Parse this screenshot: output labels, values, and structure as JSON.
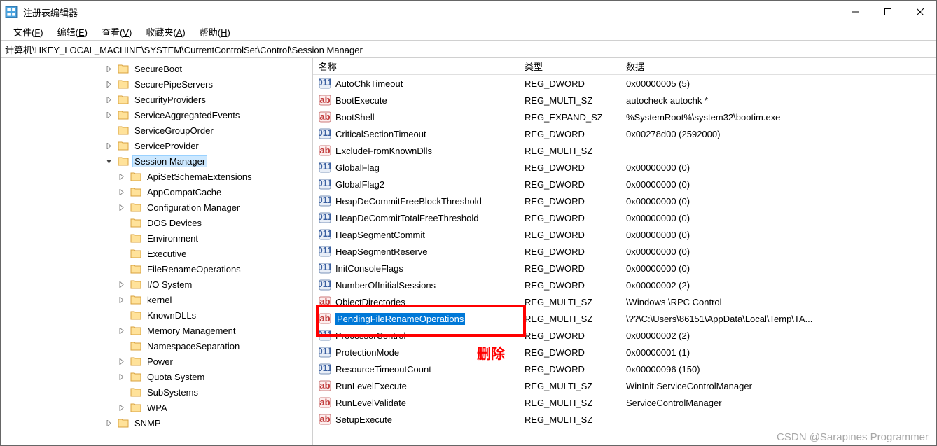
{
  "window": {
    "title": "注册表编辑器"
  },
  "menu": {
    "file": "文件(F)",
    "edit": "编辑(E)",
    "view": "查看(V)",
    "favorites": "收藏夹(A)",
    "help": "帮助(H)"
  },
  "address": {
    "path": "计算机\\HKEY_LOCAL_MACHINE\\SYSTEM\\CurrentControlSet\\Control\\Session Manager"
  },
  "tree": [
    {
      "depth": 3,
      "twisty": ">",
      "label": "SecureBoot"
    },
    {
      "depth": 3,
      "twisty": ">",
      "label": "SecurePipeServers"
    },
    {
      "depth": 3,
      "twisty": ">",
      "label": "SecurityProviders"
    },
    {
      "depth": 3,
      "twisty": ">",
      "label": "ServiceAggregatedEvents"
    },
    {
      "depth": 3,
      "twisty": "",
      "label": "ServiceGroupOrder"
    },
    {
      "depth": 3,
      "twisty": ">",
      "label": "ServiceProvider"
    },
    {
      "depth": 3,
      "twisty": "v",
      "label": "Session Manager",
      "selected": true
    },
    {
      "depth": 4,
      "twisty": ">",
      "label": "ApiSetSchemaExtensions"
    },
    {
      "depth": 4,
      "twisty": ">",
      "label": "AppCompatCache"
    },
    {
      "depth": 4,
      "twisty": ">",
      "label": "Configuration Manager"
    },
    {
      "depth": 4,
      "twisty": "",
      "label": "DOS Devices"
    },
    {
      "depth": 4,
      "twisty": "",
      "label": "Environment"
    },
    {
      "depth": 4,
      "twisty": "",
      "label": "Executive"
    },
    {
      "depth": 4,
      "twisty": "",
      "label": "FileRenameOperations"
    },
    {
      "depth": 4,
      "twisty": ">",
      "label": "I/O System"
    },
    {
      "depth": 4,
      "twisty": ">",
      "label": "kernel"
    },
    {
      "depth": 4,
      "twisty": "",
      "label": "KnownDLLs"
    },
    {
      "depth": 4,
      "twisty": ">",
      "label": "Memory Management"
    },
    {
      "depth": 4,
      "twisty": "",
      "label": "NamespaceSeparation"
    },
    {
      "depth": 4,
      "twisty": ">",
      "label": "Power"
    },
    {
      "depth": 4,
      "twisty": ">",
      "label": "Quota System"
    },
    {
      "depth": 4,
      "twisty": "",
      "label": "SubSystems"
    },
    {
      "depth": 4,
      "twisty": ">",
      "label": "WPA"
    },
    {
      "depth": 3,
      "twisty": ">",
      "label": "SNMP"
    }
  ],
  "columns": {
    "name": "名称",
    "type": "类型",
    "data": "数据"
  },
  "values": [
    {
      "icon": "bin",
      "name": "AutoChkTimeout",
      "type": "REG_DWORD",
      "data": "0x00000005 (5)"
    },
    {
      "icon": "str",
      "name": "BootExecute",
      "type": "REG_MULTI_SZ",
      "data": "autocheck autochk *"
    },
    {
      "icon": "str",
      "name": "BootShell",
      "type": "REG_EXPAND_SZ",
      "data": "%SystemRoot%\\system32\\bootim.exe"
    },
    {
      "icon": "bin",
      "name": "CriticalSectionTimeout",
      "type": "REG_DWORD",
      "data": "0x00278d00 (2592000)"
    },
    {
      "icon": "str",
      "name": "ExcludeFromKnownDlls",
      "type": "REG_MULTI_SZ",
      "data": ""
    },
    {
      "icon": "bin",
      "name": "GlobalFlag",
      "type": "REG_DWORD",
      "data": "0x00000000 (0)"
    },
    {
      "icon": "bin",
      "name": "GlobalFlag2",
      "type": "REG_DWORD",
      "data": "0x00000000 (0)"
    },
    {
      "icon": "bin",
      "name": "HeapDeCommitFreeBlockThreshold",
      "type": "REG_DWORD",
      "data": "0x00000000 (0)"
    },
    {
      "icon": "bin",
      "name": "HeapDeCommitTotalFreeThreshold",
      "type": "REG_DWORD",
      "data": "0x00000000 (0)"
    },
    {
      "icon": "bin",
      "name": "HeapSegmentCommit",
      "type": "REG_DWORD",
      "data": "0x00000000 (0)"
    },
    {
      "icon": "bin",
      "name": "HeapSegmentReserve",
      "type": "REG_DWORD",
      "data": "0x00000000 (0)"
    },
    {
      "icon": "bin",
      "name": "InitConsoleFlags",
      "type": "REG_DWORD",
      "data": "0x00000000 (0)"
    },
    {
      "icon": "bin",
      "name": "NumberOfInitialSessions",
      "type": "REG_DWORD",
      "data": "0x00000002 (2)"
    },
    {
      "icon": "str",
      "name": "ObjectDirectories",
      "type": "REG_MULTI_SZ",
      "data": "\\Windows \\RPC Control"
    },
    {
      "icon": "str",
      "name": "PendingFileRenameOperations",
      "type": "REG_MULTI_SZ",
      "data": "\\??\\C:\\Users\\86151\\AppData\\Local\\Temp\\TA...",
      "selected": true
    },
    {
      "icon": "bin",
      "name": "ProcessorControl",
      "type": "REG_DWORD",
      "data": "0x00000002 (2)"
    },
    {
      "icon": "bin",
      "name": "ProtectionMode",
      "type": "REG_DWORD",
      "data": "0x00000001 (1)"
    },
    {
      "icon": "bin",
      "name": "ResourceTimeoutCount",
      "type": "REG_DWORD",
      "data": "0x00000096 (150)"
    },
    {
      "icon": "str",
      "name": "RunLevelExecute",
      "type": "REG_MULTI_SZ",
      "data": "WinInit ServiceControlManager"
    },
    {
      "icon": "str",
      "name": "RunLevelValidate",
      "type": "REG_MULTI_SZ",
      "data": "ServiceControlManager"
    },
    {
      "icon": "str",
      "name": "SetupExecute",
      "type": "REG_MULTI_SZ",
      "data": ""
    }
  ],
  "annotation": {
    "delete_label": "删除"
  },
  "watermark": "CSDN @Sarapines Programmer"
}
